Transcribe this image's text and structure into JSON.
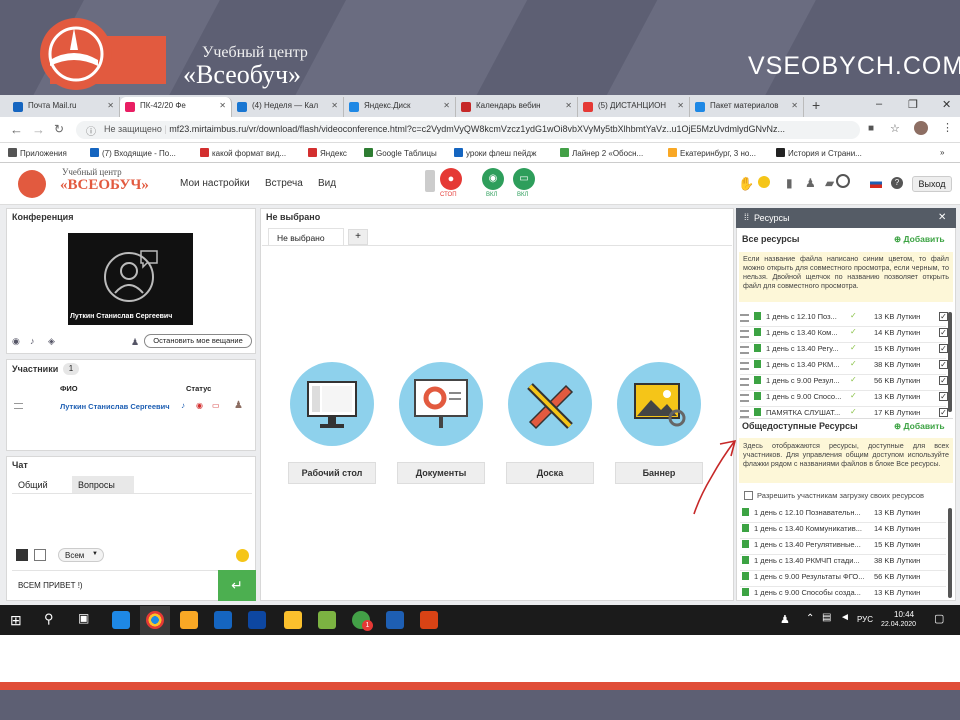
{
  "slide": {
    "center_line1": "Учебный центр",
    "center_line2": "«Всеобуч»",
    "site": "VSEOBYCH.COM"
  },
  "browser": {
    "tabs": [
      {
        "label": "Почта Mail.ru",
        "color": "#1565c0"
      },
      {
        "label": "ПК-42/20 Фе",
        "color": "#e91e63"
      },
      {
        "label": "(4) Неделя — Кал",
        "color": "#1976d2"
      },
      {
        "label": "Яндекс.Диск",
        "color": "#1e88e5"
      },
      {
        "label": "Календарь вебин",
        "color": "#c62828"
      },
      {
        "label": "(5) ДИСТАНЦИОН",
        "color": "#e53935"
      },
      {
        "label": "Пакет материалов",
        "color": "#1e88e5"
      }
    ],
    "url_prefix": "Не защищено",
    "url": "mf23.mirtaimbus.ru/vr/download/flash/videoconference.html?c=c2VydmVyQW8kcmVzcz1ydG1wOi8vbXVyMy5tbXlhbmtYaVz..u1OjE5MzUvdmlydGNvNz...",
    "bookmarks": [
      {
        "label": "Приложения",
        "color": "#555"
      },
      {
        "label": "(7) Входящие - По...",
        "color": "#1565c0"
      },
      {
        "label": "какой формат вид...",
        "color": "#d32f2f"
      },
      {
        "label": "Яндекс",
        "color": "#d32f2f"
      },
      {
        "label": "Google Таблицы",
        "color": "#2e7d32"
      },
      {
        "label": "уроки флеш пейдж",
        "color": "#1565c0"
      },
      {
        "label": "Лайнер 2 «Обосн...",
        "color": "#43a047"
      },
      {
        "label": "Екатеринбург, 3 но...",
        "color": "#f9a825"
      },
      {
        "label": "История и Страни...",
        "color": "#222"
      }
    ]
  },
  "app": {
    "logo_text": "«ВСЕОБУЧ»",
    "logo_sub": "Учебный центр",
    "menu": [
      "Мои настройки",
      "Встреча",
      "Вид"
    ],
    "media": [
      {
        "label": "СТОП",
        "color": "#e53935"
      },
      {
        "label": "ВКЛ",
        "color": "#2e9e5b"
      },
      {
        "label": "ВКЛ",
        "color": "#2e9e5b"
      }
    ],
    "exit_label": "Выход",
    "conference": {
      "title": "Конференция",
      "speaker": "Луткин Станислав Сергеевич",
      "stop_broadcast": "Остановить мое вещание"
    },
    "participants": {
      "title": "Участники",
      "count": "1",
      "col_name": "ФИО",
      "col_status": "Статус",
      "rows": [
        {
          "name": "Луткин Станислав Сергеевич"
        }
      ]
    },
    "chat": {
      "title": "Чат",
      "tabs": [
        "Общий",
        "Вопросы"
      ],
      "to_label": "Всем",
      "message": "ВСЕМ ПРИВЕТ !)"
    },
    "center": {
      "title": "Не выбрано",
      "tab_label": "Не выбрано",
      "plus": "+",
      "tiles": [
        "Рабочий стол",
        "Документы",
        "Доска",
        "Баннер"
      ]
    },
    "resources": {
      "title": "Ресурсы",
      "all_title": "Все ресурсы",
      "add_label": "Добавить",
      "hint": "Если название файла написано синим цветом, то файл можно открыть для совместного просмотра, если черным, то нельзя. Двойной щелчок по названию позволяет открыть файл для совместного просмотра.",
      "files": [
        {
          "name": "1 день с 12.10 Поз...",
          "size": "13 KB Луткин"
        },
        {
          "name": "1 день с 13.40 Ком...",
          "size": "14 KB Луткин"
        },
        {
          "name": "1 день с 13.40 Регу...",
          "size": "15 KB Луткин"
        },
        {
          "name": "1 день с 13.40 РКМ...",
          "size": "38 KB Луткин"
        },
        {
          "name": "1 день с 9.00 Резул...",
          "size": "56 KB Луткин"
        },
        {
          "name": "1 день с 9.00 Спосо...",
          "size": "13 KB Луткин"
        },
        {
          "name": "ПАМЯТКА СЛУШАТ...",
          "size": "17 KB Луткин"
        }
      ],
      "public_title": "Общедоступные Ресурсы",
      "public_hint": "Здесь отображаются ресурсы, доступные для всех участников. Для управления общим доступом используйте флажки рядом с названиями файлов в блоке Все ресурсы.",
      "allow_upload": "Разрешить участникам загрузку своих ресурсов",
      "public_files": [
        {
          "name": "1 день с 12.10 Познавательн...",
          "size": "13 KB Луткин"
        },
        {
          "name": "1 день с 13.40 Коммуникатив...",
          "size": "14 KB Луткин"
        },
        {
          "name": "1 день с 13.40 Регулятивные...",
          "size": "15 KB Луткин"
        },
        {
          "name": "1 день с 13.40 РКМЧП стади...",
          "size": "38 KB Луткин"
        },
        {
          "name": "1 день с 9.00 Результаты ФГО...",
          "size": "56 KB Луткин"
        },
        {
          "name": "1 день с 9.00 Способы созда...",
          "size": "13 KB Луткин"
        }
      ]
    }
  },
  "taskbar": {
    "lang": "РУС",
    "time": "10:44",
    "date": "22.04.2020",
    "badge": "1"
  }
}
